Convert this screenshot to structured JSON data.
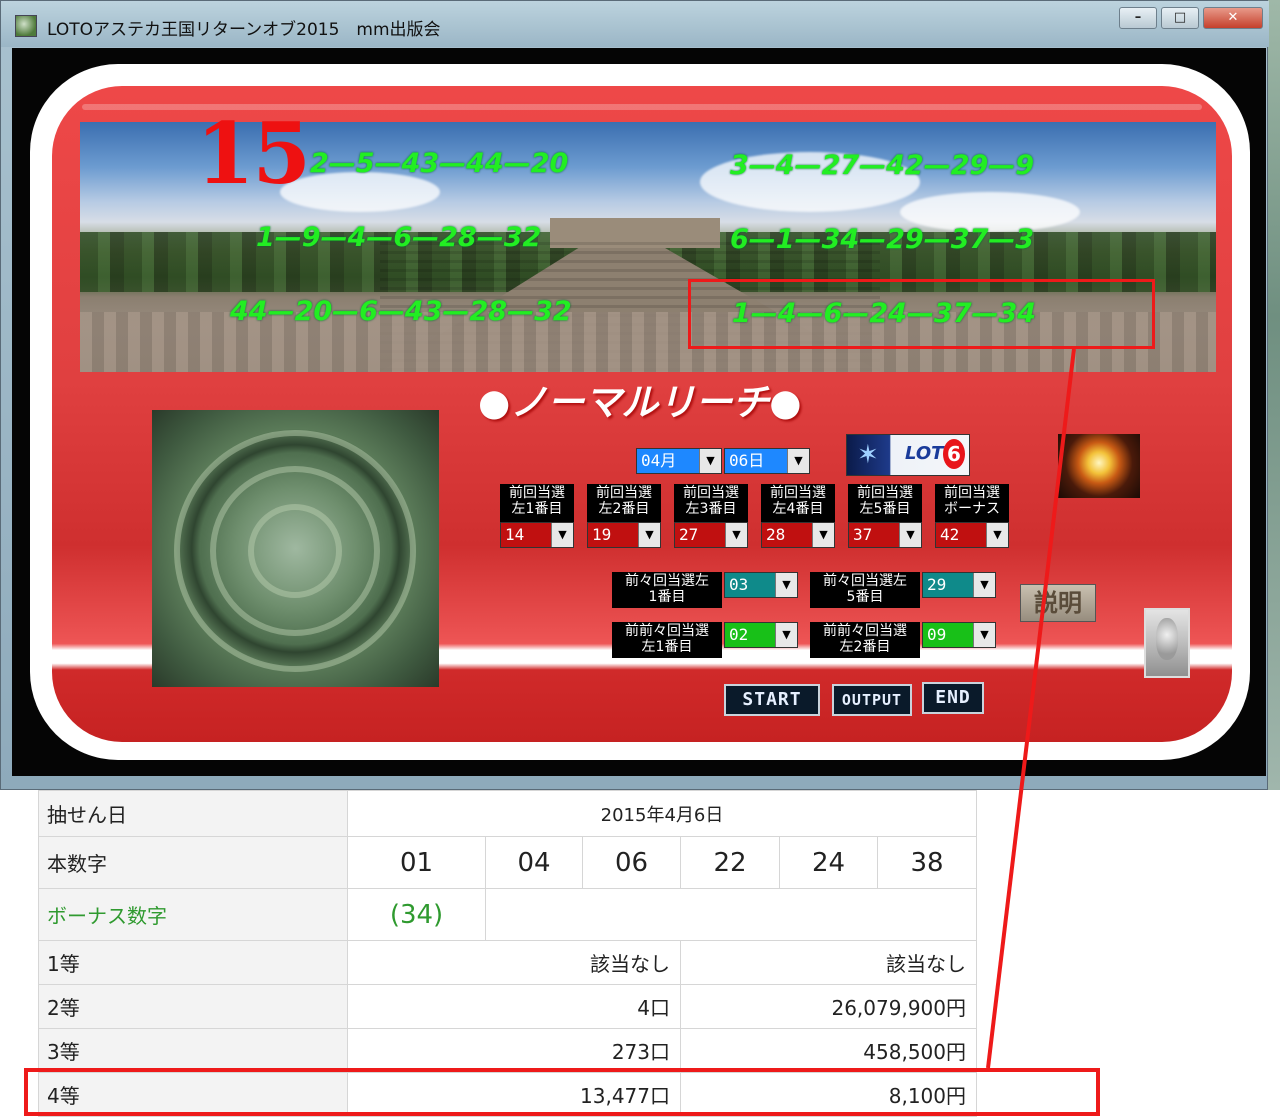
{
  "window": {
    "title": "LOTOアステカ王国リターンオブ2015　mm出版会",
    "controls": {
      "minimize": "–",
      "maximize": "□",
      "close": "✕"
    }
  },
  "banner": {
    "big_number": "15",
    "lines": [
      "2—5—43—44—20",
      "3—4—27—42—29—9",
      "1—9—4—6—28—32",
      "6—1—34—29—37—3",
      "44—20—6—43—28—32",
      "1—4—6—24—37—34"
    ]
  },
  "reach_text": "●ノーマルリーチ●",
  "date": {
    "month": "04月",
    "day": "06日"
  },
  "prev_draws": [
    {
      "label1": "前回当選",
      "label2": "左1番目",
      "value": "14"
    },
    {
      "label1": "前回当選",
      "label2": "左2番目",
      "value": "19"
    },
    {
      "label1": "前回当選",
      "label2": "左3番目",
      "value": "27"
    },
    {
      "label1": "前回当選",
      "label2": "左4番目",
      "value": "28"
    },
    {
      "label1": "前回当選",
      "label2": "左5番目",
      "value": "37"
    },
    {
      "label1": "前回当選",
      "label2": "ボーナス",
      "value": "42"
    }
  ],
  "prev2_draws": [
    {
      "label1": "前々回当選左",
      "label2": "1番目",
      "value": "03"
    },
    {
      "label1": "前々回当選左",
      "label2": "5番目",
      "value": "29"
    },
    {
      "label1": "前前々回当選",
      "label2": "左1番目",
      "value": "02"
    },
    {
      "label1": "前前々回当選",
      "label2": "左2番目",
      "value": "09"
    }
  ],
  "logo": {
    "text": "LOTO",
    "six": "6"
  },
  "explain_button": "説明",
  "buttons": {
    "start": "START",
    "output": "OUTPUT",
    "end": "END"
  },
  "results": {
    "draw_date_label": "抽せん日",
    "draw_date": "2015年4月6日",
    "main_label": "本数字",
    "main_numbers": [
      "01",
      "04",
      "06",
      "22",
      "24",
      "38"
    ],
    "bonus_label": "ボーナス数字",
    "bonus_number": "(34)",
    "prizes": [
      {
        "rank": "1等",
        "count": "該当なし",
        "amount": "該当なし"
      },
      {
        "rank": "2等",
        "count": "4口",
        "amount": "26,079,900円"
      },
      {
        "rank": "3等",
        "count": "273口",
        "amount": "458,500円"
      },
      {
        "rank": "4等",
        "count": "13,477口",
        "amount": "8,100円"
      }
    ]
  },
  "colors": {
    "accent_red": "#ee1a1a",
    "number_green": "#22ee22",
    "bonus_green": "#2f9a2f"
  }
}
